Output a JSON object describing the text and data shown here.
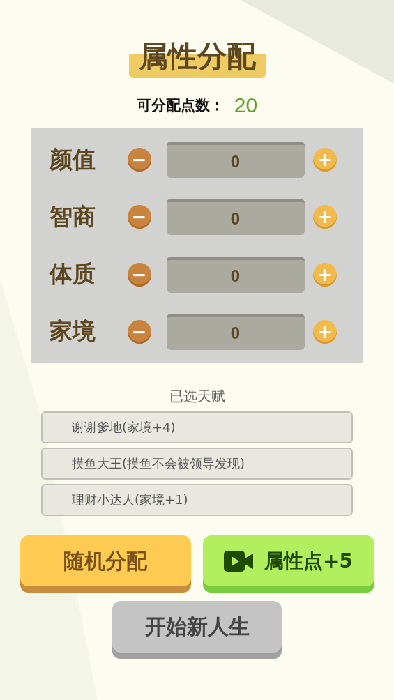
{
  "title": "属性分配",
  "points": {
    "label": "可分配点数：",
    "value": "20"
  },
  "attributes": [
    {
      "name": "颜值",
      "value": "0",
      "minus": "−",
      "plus": "+"
    },
    {
      "name": "智商",
      "value": "0",
      "minus": "−",
      "plus": "+"
    },
    {
      "name": "体质",
      "value": "0",
      "minus": "−",
      "plus": "+"
    },
    {
      "name": "家境",
      "value": "0",
      "minus": "−",
      "plus": "+"
    }
  ],
  "talents": {
    "heading": "已选天赋",
    "items": [
      "谢谢爹地(家境+4)",
      "摸鱼大王(摸鱼不会被领导发现)",
      "理财小达人(家境+1)"
    ]
  },
  "buttons": [
    {
      "kind": "random",
      "label": "随机分配"
    },
    {
      "kind": "video",
      "label": "属性点+5"
    },
    {
      "kind": "start",
      "label": "开始新人生"
    }
  ]
}
